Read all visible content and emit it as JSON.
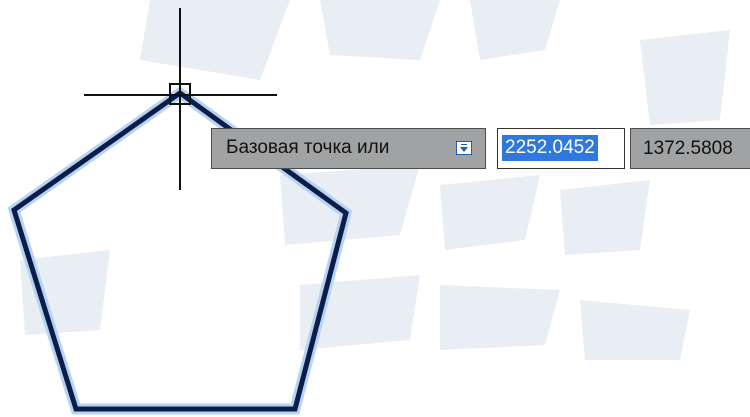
{
  "drawing": {
    "polygon_type": "pentagon",
    "outline_color": "#0d1d4a",
    "glow_color": "#b7d3f2",
    "crosshair_color": "#111111",
    "watermark_color": "#e9eef4"
  },
  "dynamic_input": {
    "prompt_label": "Базовая точка или",
    "options_icon": "dropdown-arrow-icon",
    "x_value": "2252.0452",
    "y_value": "1372.5808",
    "selection_color": "#2f78dc"
  }
}
